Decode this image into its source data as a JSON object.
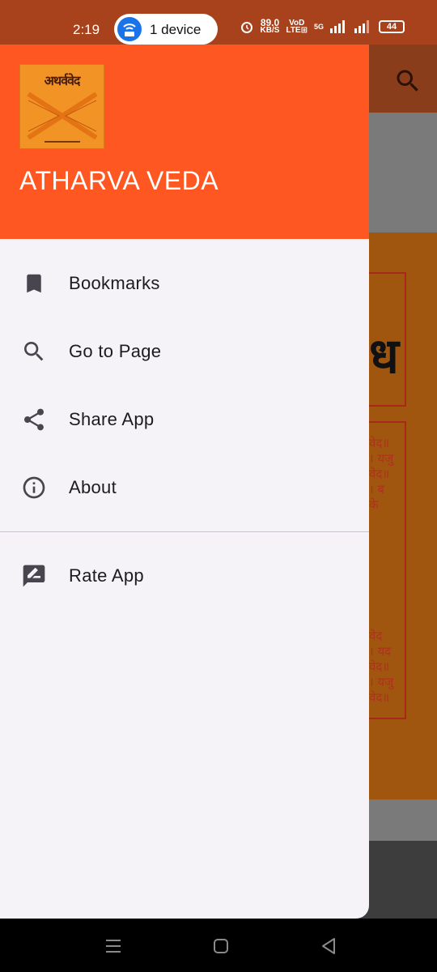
{
  "status_bar": {
    "time": "2:19",
    "connected_devices": "1 device",
    "network_speed_value": "89.0",
    "network_speed_unit": "KB/S",
    "volte_top": "VoD",
    "volte_bottom": "LTE⊞",
    "network_type": "5G",
    "battery_level": "44"
  },
  "drawer": {
    "logo_text": "अथर्ववेद",
    "app_title": "ATHARVA VEDA",
    "menu_items": [
      {
        "label": "Bookmarks",
        "icon": "bookmark-icon"
      },
      {
        "label": "Go to Page",
        "icon": "search-icon"
      },
      {
        "label": "Share App",
        "icon": "share-icon"
      },
      {
        "label": "About",
        "icon": "info-icon"
      }
    ],
    "secondary_items": [
      {
        "label": "Rate App",
        "icon": "rate-review-icon"
      }
    ]
  },
  "background_page": {
    "lines_top": [
      "वेद॥",
      "। यजु",
      "वेद॥",
      "। ब",
      "के"
    ],
    "lines_bottom": [
      "वेद",
      "। यद",
      "वेद॥",
      "। यजु",
      "वेद॥"
    ]
  },
  "colors": {
    "header": "#ff5722",
    "drawer_bg": "#f5f2f8",
    "status_bar": "#a8421c"
  }
}
